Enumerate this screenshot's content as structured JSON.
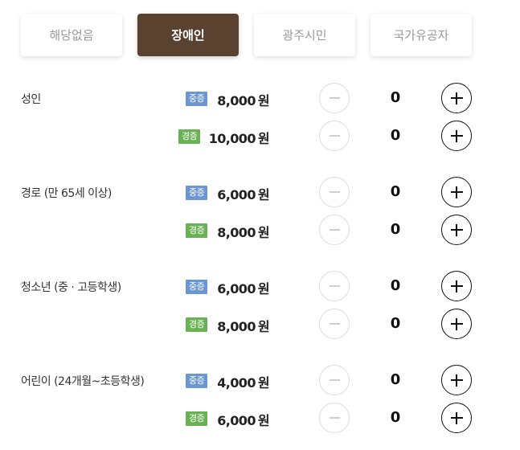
{
  "tabs": [
    {
      "label": "해당없음",
      "active": false
    },
    {
      "label": "장애인",
      "active": true
    },
    {
      "label": "광주시민",
      "active": false
    },
    {
      "label": "국가유공자",
      "active": false
    }
  ],
  "groups": [
    {
      "label": "성인",
      "rows": [
        {
          "badge": "중증",
          "badge_color": "#6c96cf",
          "price": "8,000",
          "unit": "원",
          "quantity": "0"
        },
        {
          "badge": "경증",
          "badge_color": "#6ab155",
          "price": "10,000",
          "unit": "원",
          "quantity": "0"
        }
      ]
    },
    {
      "label": "경로 (만 65세 이상)",
      "rows": [
        {
          "badge": "중증",
          "badge_color": "#6c96cf",
          "price": "6,000",
          "unit": "원",
          "quantity": "0"
        },
        {
          "badge": "경증",
          "badge_color": "#6ab155",
          "price": "8,000",
          "unit": "원",
          "quantity": "0"
        }
      ]
    },
    {
      "label": "청소년 (중 · 고등학생)",
      "rows": [
        {
          "badge": "중증",
          "badge_color": "#6c96cf",
          "price": "6,000",
          "unit": "원",
          "quantity": "0"
        },
        {
          "badge": "경증",
          "badge_color": "#6ab155",
          "price": "8,000",
          "unit": "원",
          "quantity": "0"
        }
      ]
    },
    {
      "label": "어린이 (24개월~초등학생)",
      "rows": [
        {
          "badge": "중증",
          "badge_color": "#6c96cf",
          "price": "4,000",
          "unit": "원",
          "quantity": "0"
        },
        {
          "badge": "경증",
          "badge_color": "#6ab155",
          "price": "6,000",
          "unit": "원",
          "quantity": "0"
        }
      ]
    }
  ],
  "colors": {
    "active_tab": "#5a4230",
    "badge_severe": "#6c96cf",
    "badge_mild": "#6ab155"
  },
  "icons": {
    "minus": "minus-icon",
    "plus": "plus-icon"
  }
}
